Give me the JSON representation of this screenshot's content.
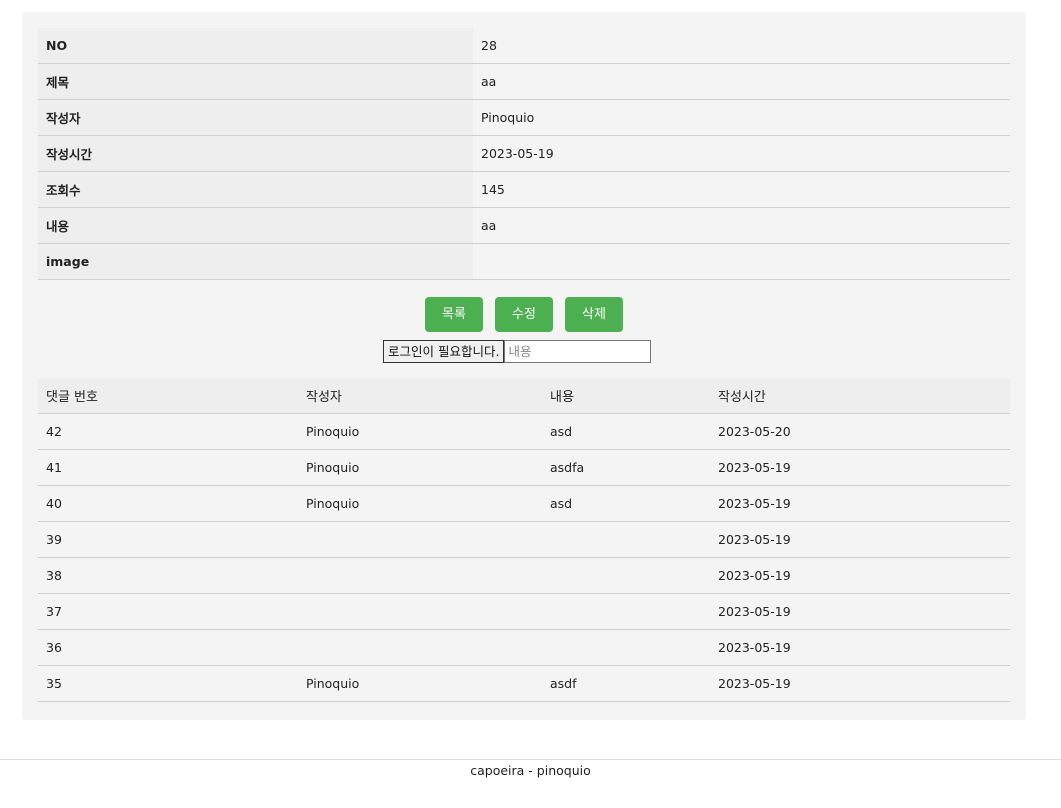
{
  "post": {
    "fields": [
      {
        "label": "NO",
        "value": "28"
      },
      {
        "label": "제목",
        "value": "aa"
      },
      {
        "label": "작성자",
        "value": "Pinoquio"
      },
      {
        "label": "작성시간",
        "value": "2023-05-19"
      },
      {
        "label": "조회수",
        "value": "145"
      },
      {
        "label": "내용",
        "value": "aa"
      },
      {
        "label": "image",
        "value": ""
      }
    ]
  },
  "actions": {
    "list_label": "목록",
    "edit_label": "수정",
    "delete_label": "삭제"
  },
  "comment_form": {
    "login_label": "로그인이 필요합니다.",
    "placeholder": "내용"
  },
  "comments": {
    "headers": [
      "댓글 번호",
      "작성자",
      "내용",
      "작성시간"
    ],
    "rows": [
      {
        "no": "42",
        "author": "Pinoquio",
        "content": "asd",
        "time": "2023-05-20"
      },
      {
        "no": "41",
        "author": "Pinoquio",
        "content": "asdfa",
        "time": "2023-05-19"
      },
      {
        "no": "40",
        "author": "Pinoquio",
        "content": "asd",
        "time": "2023-05-19"
      },
      {
        "no": "39",
        "author": "",
        "content": "",
        "time": "2023-05-19"
      },
      {
        "no": "38",
        "author": "",
        "content": "",
        "time": "2023-05-19"
      },
      {
        "no": "37",
        "author": "",
        "content": "",
        "time": "2023-05-19"
      },
      {
        "no": "36",
        "author": "",
        "content": "",
        "time": "2023-05-19"
      },
      {
        "no": "35",
        "author": "Pinoquio",
        "content": "asdf",
        "time": "2023-05-19"
      }
    ]
  },
  "footer": {
    "text": "capoeira - pinoquio"
  },
  "colors": {
    "button": "#4caf50",
    "panel": "#f4f4f4"
  }
}
